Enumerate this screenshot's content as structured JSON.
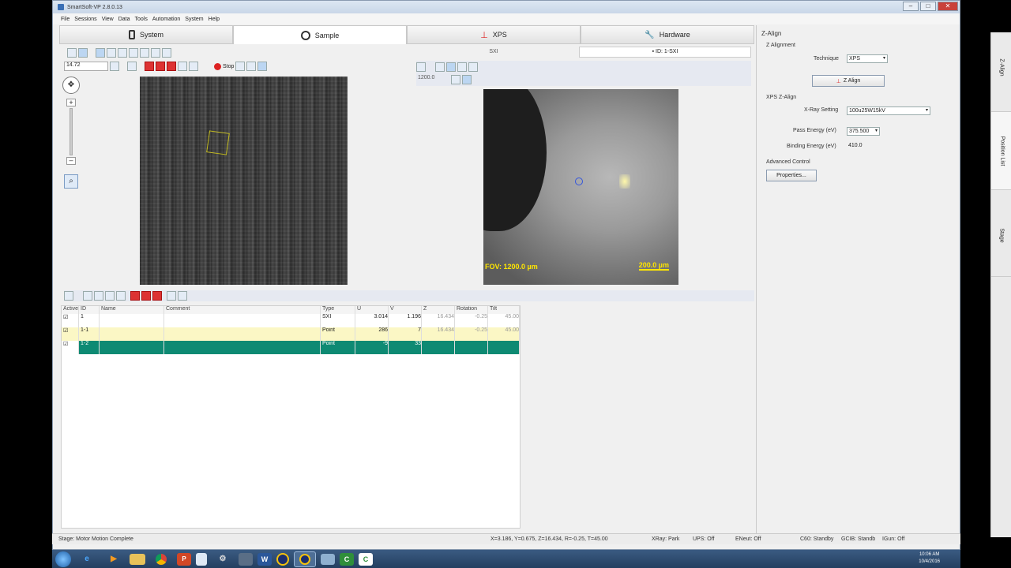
{
  "window": {
    "title": "SmartSoft-VP 2.8.0.13"
  },
  "menu": [
    "File",
    "Sessions",
    "View",
    "Data",
    "Tools",
    "Automation",
    "System",
    "Help"
  ],
  "tabs": [
    {
      "label": "System"
    },
    {
      "label": "Sample"
    },
    {
      "label": "XPS"
    },
    {
      "label": "Hardware"
    }
  ],
  "sample": {
    "zoom_value": "14.72",
    "stop_label": "Stop"
  },
  "xps": {
    "source_label": "SXI",
    "id_label": "ID: 1-SXI",
    "fov_value": "1200.0",
    "fov_text": "FOV: 1200.0 µm",
    "scale_text": "200.0 µm"
  },
  "table": {
    "columns": [
      "Active",
      "ID",
      "Name",
      "Comment",
      "Type",
      "U",
      "V",
      "Z",
      "Rotation",
      "Tilt"
    ],
    "rows": [
      {
        "id": "1",
        "name": "",
        "comment": "",
        "type": "SXI",
        "u": "3.014",
        "v": "1.196",
        "z": "16.434",
        "rotation": "-0.25",
        "tilt": "45.00"
      },
      {
        "id": "1-1",
        "name": "",
        "comment": "",
        "type": "Point",
        "u": "286",
        "v": "7",
        "z": "16.434",
        "rotation": "-0.25",
        "tilt": "45.00"
      },
      {
        "id": "1-2",
        "name": "",
        "comment": "",
        "type": "Point",
        "u": "-9",
        "v": "33",
        "z": "",
        "rotation": "",
        "tilt": ""
      }
    ]
  },
  "zalign": {
    "title": "Z-Align",
    "section": "Z Alignment",
    "technique_label": "Technique",
    "technique_value": "XPS",
    "button_label": "Z Align",
    "xps_section": "XPS Z-Align",
    "xray_label": "X-Ray Setting",
    "xray_value": "100u25W15kV",
    "pass_label": "Pass Energy (eV)",
    "pass_value": "375.500",
    "binding_label": "Binding Energy (eV)",
    "binding_value": "410.0",
    "advanced_label": "Advanced Control",
    "properties_label": "Properties..."
  },
  "side_tabs": [
    "Z-Align",
    "Position List",
    "Stage"
  ],
  "status": {
    "message": "Stage: Motor Motion Complete",
    "coords": "X=3.186, Y=0.675, Z=16.434, R=-0.25, T=45.00",
    "xray": "XRay: Park",
    "ups": "UPS: Off",
    "eneut": "ENeut: Off",
    "c60": "C60: Standby",
    "gcib": "GCIB: Standb",
    "igun": "IGun: Off"
  },
  "clock": {
    "time": "10:06 AM",
    "date": "10/4/2016"
  },
  "taskbar": [
    "W",
    "C"
  ]
}
